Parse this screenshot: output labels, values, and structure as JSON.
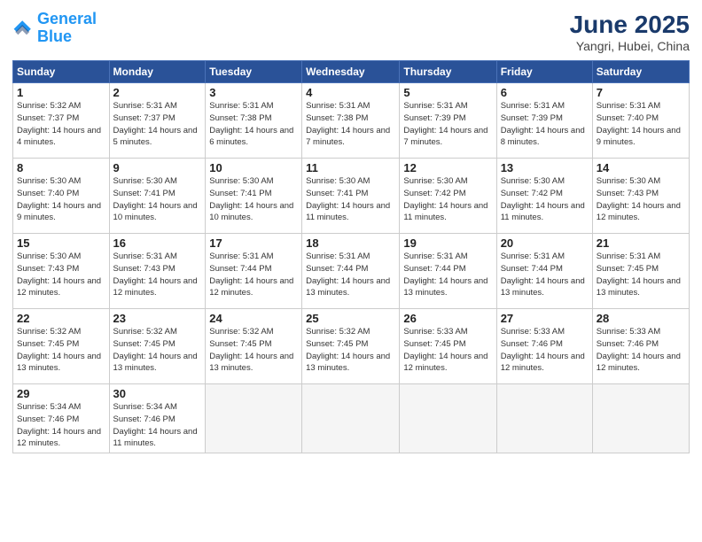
{
  "header": {
    "logo_general": "General",
    "logo_blue": "Blue",
    "month_title": "June 2025",
    "location": "Yangri, Hubei, China"
  },
  "calendar": {
    "days_of_week": [
      "Sunday",
      "Monday",
      "Tuesday",
      "Wednesday",
      "Thursday",
      "Friday",
      "Saturday"
    ],
    "weeks": [
      [
        {
          "day": "1",
          "sunrise": "5:32 AM",
          "sunset": "7:37 PM",
          "daylight": "14 hours and 4 minutes."
        },
        {
          "day": "2",
          "sunrise": "5:31 AM",
          "sunset": "7:37 PM",
          "daylight": "14 hours and 5 minutes."
        },
        {
          "day": "3",
          "sunrise": "5:31 AM",
          "sunset": "7:38 PM",
          "daylight": "14 hours and 6 minutes."
        },
        {
          "day": "4",
          "sunrise": "5:31 AM",
          "sunset": "7:38 PM",
          "daylight": "14 hours and 7 minutes."
        },
        {
          "day": "5",
          "sunrise": "5:31 AM",
          "sunset": "7:39 PM",
          "daylight": "14 hours and 7 minutes."
        },
        {
          "day": "6",
          "sunrise": "5:31 AM",
          "sunset": "7:39 PM",
          "daylight": "14 hours and 8 minutes."
        },
        {
          "day": "7",
          "sunrise": "5:31 AM",
          "sunset": "7:40 PM",
          "daylight": "14 hours and 9 minutes."
        }
      ],
      [
        {
          "day": "8",
          "sunrise": "5:30 AM",
          "sunset": "7:40 PM",
          "daylight": "14 hours and 9 minutes."
        },
        {
          "day": "9",
          "sunrise": "5:30 AM",
          "sunset": "7:41 PM",
          "daylight": "14 hours and 10 minutes."
        },
        {
          "day": "10",
          "sunrise": "5:30 AM",
          "sunset": "7:41 PM",
          "daylight": "14 hours and 10 minutes."
        },
        {
          "day": "11",
          "sunrise": "5:30 AM",
          "sunset": "7:41 PM",
          "daylight": "14 hours and 11 minutes."
        },
        {
          "day": "12",
          "sunrise": "5:30 AM",
          "sunset": "7:42 PM",
          "daylight": "14 hours and 11 minutes."
        },
        {
          "day": "13",
          "sunrise": "5:30 AM",
          "sunset": "7:42 PM",
          "daylight": "14 hours and 11 minutes."
        },
        {
          "day": "14",
          "sunrise": "5:30 AM",
          "sunset": "7:43 PM",
          "daylight": "14 hours and 12 minutes."
        }
      ],
      [
        {
          "day": "15",
          "sunrise": "5:30 AM",
          "sunset": "7:43 PM",
          "daylight": "14 hours and 12 minutes."
        },
        {
          "day": "16",
          "sunrise": "5:31 AM",
          "sunset": "7:43 PM",
          "daylight": "14 hours and 12 minutes."
        },
        {
          "day": "17",
          "sunrise": "5:31 AM",
          "sunset": "7:44 PM",
          "daylight": "14 hours and 12 minutes."
        },
        {
          "day": "18",
          "sunrise": "5:31 AM",
          "sunset": "7:44 PM",
          "daylight": "14 hours and 13 minutes."
        },
        {
          "day": "19",
          "sunrise": "5:31 AM",
          "sunset": "7:44 PM",
          "daylight": "14 hours and 13 minutes."
        },
        {
          "day": "20",
          "sunrise": "5:31 AM",
          "sunset": "7:44 PM",
          "daylight": "14 hours and 13 minutes."
        },
        {
          "day": "21",
          "sunrise": "5:31 AM",
          "sunset": "7:45 PM",
          "daylight": "14 hours and 13 minutes."
        }
      ],
      [
        {
          "day": "22",
          "sunrise": "5:32 AM",
          "sunset": "7:45 PM",
          "daylight": "14 hours and 13 minutes."
        },
        {
          "day": "23",
          "sunrise": "5:32 AM",
          "sunset": "7:45 PM",
          "daylight": "14 hours and 13 minutes."
        },
        {
          "day": "24",
          "sunrise": "5:32 AM",
          "sunset": "7:45 PM",
          "daylight": "14 hours and 13 minutes."
        },
        {
          "day": "25",
          "sunrise": "5:32 AM",
          "sunset": "7:45 PM",
          "daylight": "14 hours and 13 minutes."
        },
        {
          "day": "26",
          "sunrise": "5:33 AM",
          "sunset": "7:45 PM",
          "daylight": "14 hours and 12 minutes."
        },
        {
          "day": "27",
          "sunrise": "5:33 AM",
          "sunset": "7:46 PM",
          "daylight": "14 hours and 12 minutes."
        },
        {
          "day": "28",
          "sunrise": "5:33 AM",
          "sunset": "7:46 PM",
          "daylight": "14 hours and 12 minutes."
        }
      ],
      [
        {
          "day": "29",
          "sunrise": "5:34 AM",
          "sunset": "7:46 PM",
          "daylight": "14 hours and 12 minutes."
        },
        {
          "day": "30",
          "sunrise": "5:34 AM",
          "sunset": "7:46 PM",
          "daylight": "14 hours and 11 minutes."
        },
        null,
        null,
        null,
        null,
        null
      ]
    ]
  },
  "labels": {
    "sunrise_prefix": "Sunrise: ",
    "sunset_prefix": "Sunset: ",
    "daylight_prefix": "Daylight: "
  }
}
